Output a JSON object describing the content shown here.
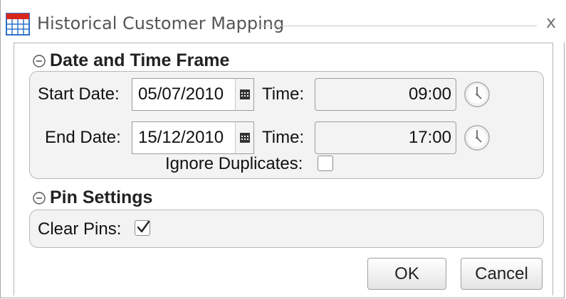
{
  "window": {
    "title": "Historical Customer Mapping",
    "close_label": "x"
  },
  "date_time_section": {
    "header": "Date and Time Frame",
    "start_date_label": "Start Date:",
    "start_date_value": "05/07/2010",
    "start_time_label": "Time:",
    "start_time_value": "09:00",
    "end_date_label": "End Date:",
    "end_date_value": "15/12/2010",
    "end_time_label": "Time:",
    "end_time_value": "17:00",
    "ignore_duplicates_label": "Ignore Duplicates:",
    "ignore_duplicates_checked": false
  },
  "pin_section": {
    "header": "Pin Settings",
    "clear_pins_label": "Clear Pins:",
    "clear_pins_checked": true
  },
  "buttons": {
    "ok": "OK",
    "cancel": "Cancel"
  },
  "icons": {
    "window_icon": "calendar-grid-icon",
    "collapse": "collapse-circle-icon",
    "date_picker": "calendar-icon",
    "time_picker": "clock-icon",
    "check": "checkmark-icon"
  },
  "colors": {
    "group_background": "#f3f3f3",
    "calendar_icon_red": "#d9261c",
    "calendar_icon_blue": "#2e73c8"
  }
}
